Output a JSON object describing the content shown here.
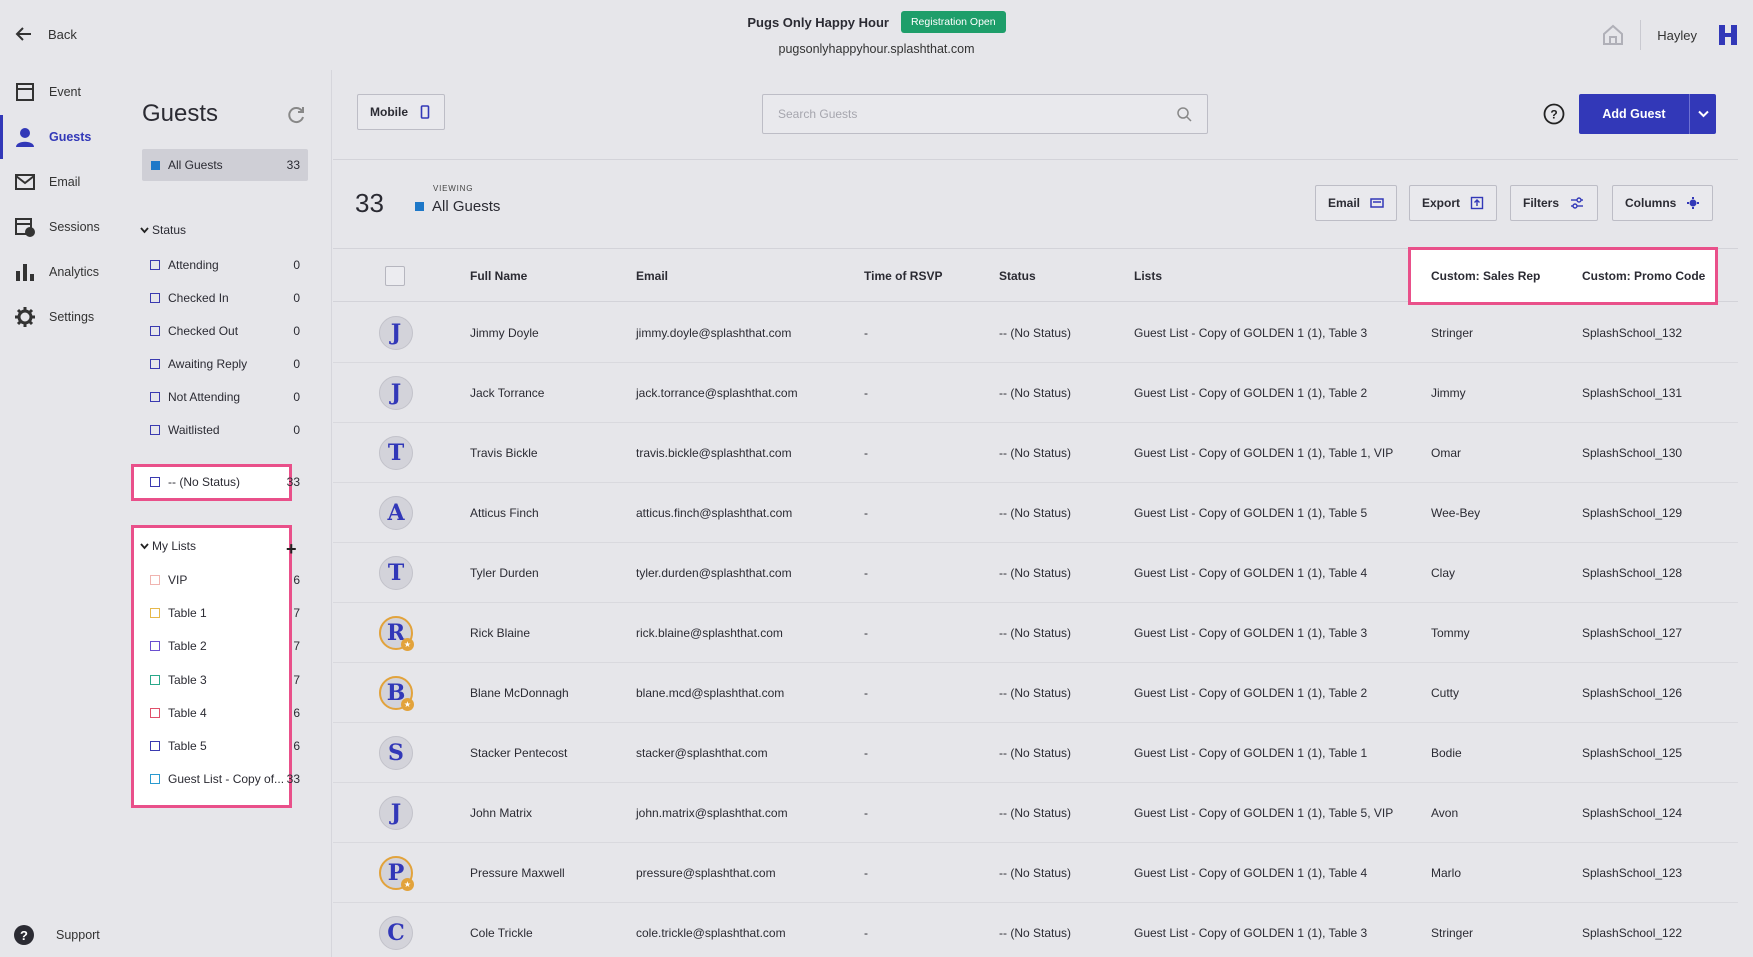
{
  "header": {
    "back_label": "Back",
    "event_name": "Pugs Only Happy Hour",
    "registration_badge": "Registration Open",
    "event_url": "pugsonlyhappyhour.splashthat.com",
    "user_name": "Hayley"
  },
  "nav": {
    "items": [
      {
        "label": "Event",
        "icon": "calendar-icon"
      },
      {
        "label": "Guests",
        "icon": "person-icon"
      },
      {
        "label": "Email",
        "icon": "envelope-icon"
      },
      {
        "label": "Sessions",
        "icon": "sessions-icon"
      },
      {
        "label": "Analytics",
        "icon": "bar-chart-icon"
      },
      {
        "label": "Settings",
        "icon": "gear-icon"
      }
    ],
    "support_label": "Support"
  },
  "panel": {
    "title": "Guests",
    "all_guests": {
      "label": "All Guests",
      "count": "33"
    },
    "status_heading": "Status",
    "status_items": [
      {
        "label": "Attending",
        "count": "0"
      },
      {
        "label": "Checked In",
        "count": "0"
      },
      {
        "label": "Checked Out",
        "count": "0"
      },
      {
        "label": "Awaiting Reply",
        "count": "0"
      },
      {
        "label": "Not Attending",
        "count": "0"
      },
      {
        "label": "Waitlisted",
        "count": "0"
      },
      {
        "label": "-- (No Status)",
        "count": "33"
      }
    ],
    "lists_heading": "My Lists",
    "lists": [
      {
        "label": "VIP",
        "count": "6",
        "color": "#f0b4b0"
      },
      {
        "label": "Table 1",
        "count": "7",
        "color": "#e6b84a"
      },
      {
        "label": "Table 2",
        "count": "7",
        "color": "#6a4fd0"
      },
      {
        "label": "Table 3",
        "count": "7",
        "color": "#2aa88a"
      },
      {
        "label": "Table 4",
        "count": "6",
        "color": "#e0506a"
      },
      {
        "label": "Table 5",
        "count": "6",
        "color": "#3a3ab0"
      },
      {
        "label": "Guest List - Copy of...",
        "count": "33",
        "color": "#2a9ad0"
      }
    ]
  },
  "toolbar": {
    "mobile_label": "Mobile",
    "search_placeholder": "Search Guests",
    "add_guest_label": "Add Guest",
    "count": "33",
    "viewing_label": "VIEWING",
    "viewing_value": "All Guests",
    "email_label": "Email",
    "export_label": "Export",
    "filters_label": "Filters",
    "columns_label": "Columns"
  },
  "table": {
    "headers": [
      "Full Name",
      "Email",
      "Time of RSVP",
      "Status",
      "Lists",
      "Custom: Sales Rep",
      "Custom: Promo Code"
    ],
    "rows": [
      {
        "initial": "J",
        "vip": false,
        "name": "Jimmy Doyle",
        "email": "jimmy.doyle@splashthat.com",
        "rsvp": "-",
        "status": "-- (No Status)",
        "lists": "Guest List - Copy of GOLDEN 1 (1), Table 3",
        "rep": "Stringer",
        "promo": "SplashSchool_132"
      },
      {
        "initial": "J",
        "vip": false,
        "name": "Jack Torrance",
        "email": "jack.torrance@splashthat.com",
        "rsvp": "-",
        "status": "-- (No Status)",
        "lists": "Guest List - Copy of GOLDEN 1 (1), Table 2",
        "rep": "Jimmy",
        "promo": "SplashSchool_131"
      },
      {
        "initial": "T",
        "vip": false,
        "name": "Travis Bickle",
        "email": "travis.bickle@splashthat.com",
        "rsvp": "-",
        "status": "-- (No Status)",
        "lists": "Guest List - Copy of GOLDEN 1 (1), Table 1, VIP",
        "rep": "Omar",
        "promo": "SplashSchool_130"
      },
      {
        "initial": "A",
        "vip": false,
        "name": "Atticus Finch",
        "email": "atticus.finch@splashthat.com",
        "rsvp": "-",
        "status": "-- (No Status)",
        "lists": "Guest List - Copy of GOLDEN 1 (1), Table 5",
        "rep": "Wee-Bey",
        "promo": "SplashSchool_129"
      },
      {
        "initial": "T",
        "vip": false,
        "name": "Tyler Durden",
        "email": "tyler.durden@splashthat.com",
        "rsvp": "-",
        "status": "-- (No Status)",
        "lists": "Guest List - Copy of GOLDEN 1 (1), Table 4",
        "rep": "Clay",
        "promo": "SplashSchool_128"
      },
      {
        "initial": "R",
        "vip": true,
        "name": "Rick Blaine",
        "email": "rick.blaine@splashthat.com",
        "rsvp": "-",
        "status": "-- (No Status)",
        "lists": "Guest List - Copy of GOLDEN 1 (1), Table 3",
        "rep": "Tommy",
        "promo": "SplashSchool_127"
      },
      {
        "initial": "B",
        "vip": true,
        "name": "Blane McDonnagh",
        "email": "blane.mcd@splashthat.com",
        "rsvp": "-",
        "status": "-- (No Status)",
        "lists": "Guest List - Copy of GOLDEN 1 (1), Table 2",
        "rep": "Cutty",
        "promo": "SplashSchool_126"
      },
      {
        "initial": "S",
        "vip": false,
        "name": "Stacker Pentecost",
        "email": "stacker@splashthat.com",
        "rsvp": "-",
        "status": "-- (No Status)",
        "lists": "Guest List - Copy of GOLDEN 1 (1), Table 1",
        "rep": "Bodie",
        "promo": "SplashSchool_125"
      },
      {
        "initial": "J",
        "vip": false,
        "name": "John Matrix",
        "email": "john.matrix@splashthat.com",
        "rsvp": "-",
        "status": "-- (No Status)",
        "lists": "Guest List - Copy of GOLDEN 1 (1), Table 5, VIP",
        "rep": "Avon",
        "promo": "SplashSchool_124"
      },
      {
        "initial": "P",
        "vip": true,
        "name": "Pressure Maxwell",
        "email": "pressure@splashthat.com",
        "rsvp": "-",
        "status": "-- (No Status)",
        "lists": "Guest List - Copy of GOLDEN 1 (1), Table 4",
        "rep": "Marlo",
        "promo": "SplashSchool_123"
      },
      {
        "initial": "C",
        "vip": false,
        "name": "Cole Trickle",
        "email": "cole.trickle@splashthat.com",
        "rsvp": "-",
        "status": "-- (No Status)",
        "lists": "Guest List - Copy of GOLDEN 1 (1), Table 3",
        "rep": "Stringer",
        "promo": "SplashSchool_122"
      }
    ]
  },
  "colors": {
    "accent": "#3238b8",
    "badge": "#1e9e6a",
    "highlight": "#e9508a",
    "vip_ring": "#e2a33c"
  }
}
